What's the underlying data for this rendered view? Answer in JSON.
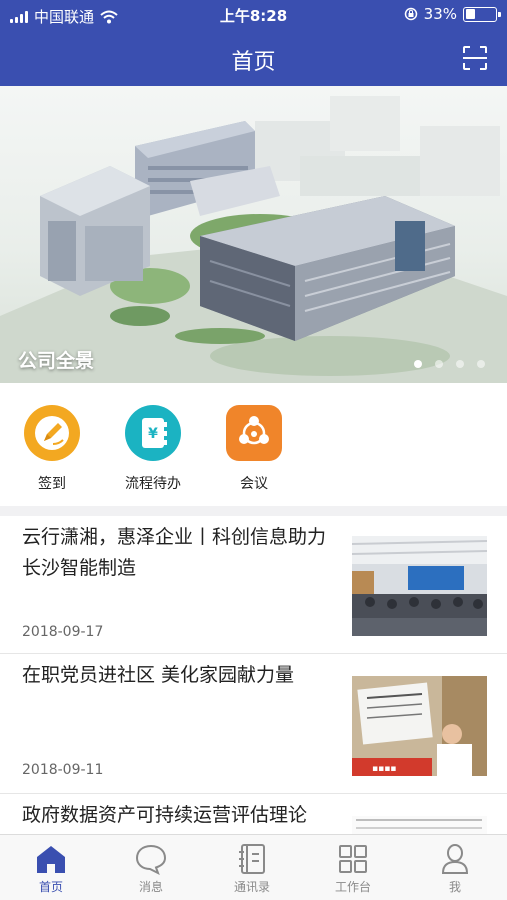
{
  "status_bar": {
    "carrier": "中国联通",
    "time": "上午8:28",
    "battery": "33%",
    "battery_level": 0.33,
    "icons": [
      "signal-icon",
      "wifi-icon",
      "rotation-lock-icon",
      "battery-icon"
    ]
  },
  "nav": {
    "title": "首页",
    "right_icon": "scan-icon"
  },
  "banner": {
    "caption": "公司全景",
    "page_count": 4,
    "active_index": 0
  },
  "quick_actions": [
    {
      "label": "签到",
      "icon": "pen-icon",
      "color": "#f3a821"
    },
    {
      "label": "流程待办",
      "icon": "yuan-notebook-icon",
      "color": "#1bb3c2"
    },
    {
      "label": "会议",
      "icon": "meeting-icon",
      "color": "#f0852a"
    }
  ],
  "news": [
    {
      "title": "云行潇湘，惠泽企业丨科创信息助力长沙智能制造",
      "date": "2018-09-17"
    },
    {
      "title": "在职党员进社区 美化家园献力量",
      "date": "2018-09-11"
    },
    {
      "title": "政府数据资产可持续运营评估理论",
      "date": ""
    }
  ],
  "tab_bar": [
    {
      "label": "首页",
      "icon": "home-icon",
      "active": true
    },
    {
      "label": "消息",
      "icon": "message-icon",
      "active": false
    },
    {
      "label": "通讯录",
      "icon": "contacts-icon",
      "active": false
    },
    {
      "label": "工作台",
      "icon": "grid-icon",
      "active": false
    },
    {
      "label": "我",
      "icon": "person-icon",
      "active": false
    }
  ],
  "colors": {
    "primary": "#3a4fb0",
    "tab_inactive": "#8a8a8a"
  }
}
